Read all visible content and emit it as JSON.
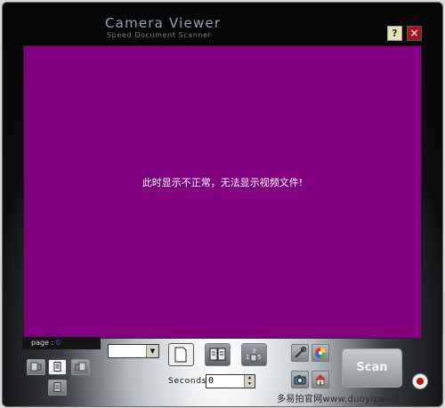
{
  "window": {
    "title": "Camera  Viewer",
    "subtitle": "Speed Document Scanner",
    "help_label": "?",
    "close_label": "×"
  },
  "viewer": {
    "background": "#800080",
    "message": "此时显示不正常，无法显示视频文件!"
  },
  "page": {
    "label": "page : ",
    "number": "0"
  },
  "controls": {
    "resolution_value": "",
    "seconds_label": "Seconds",
    "seconds_value": "0",
    "scan_label": "Scan"
  },
  "watermark": "多易拍官网www.duoyipai.com"
}
